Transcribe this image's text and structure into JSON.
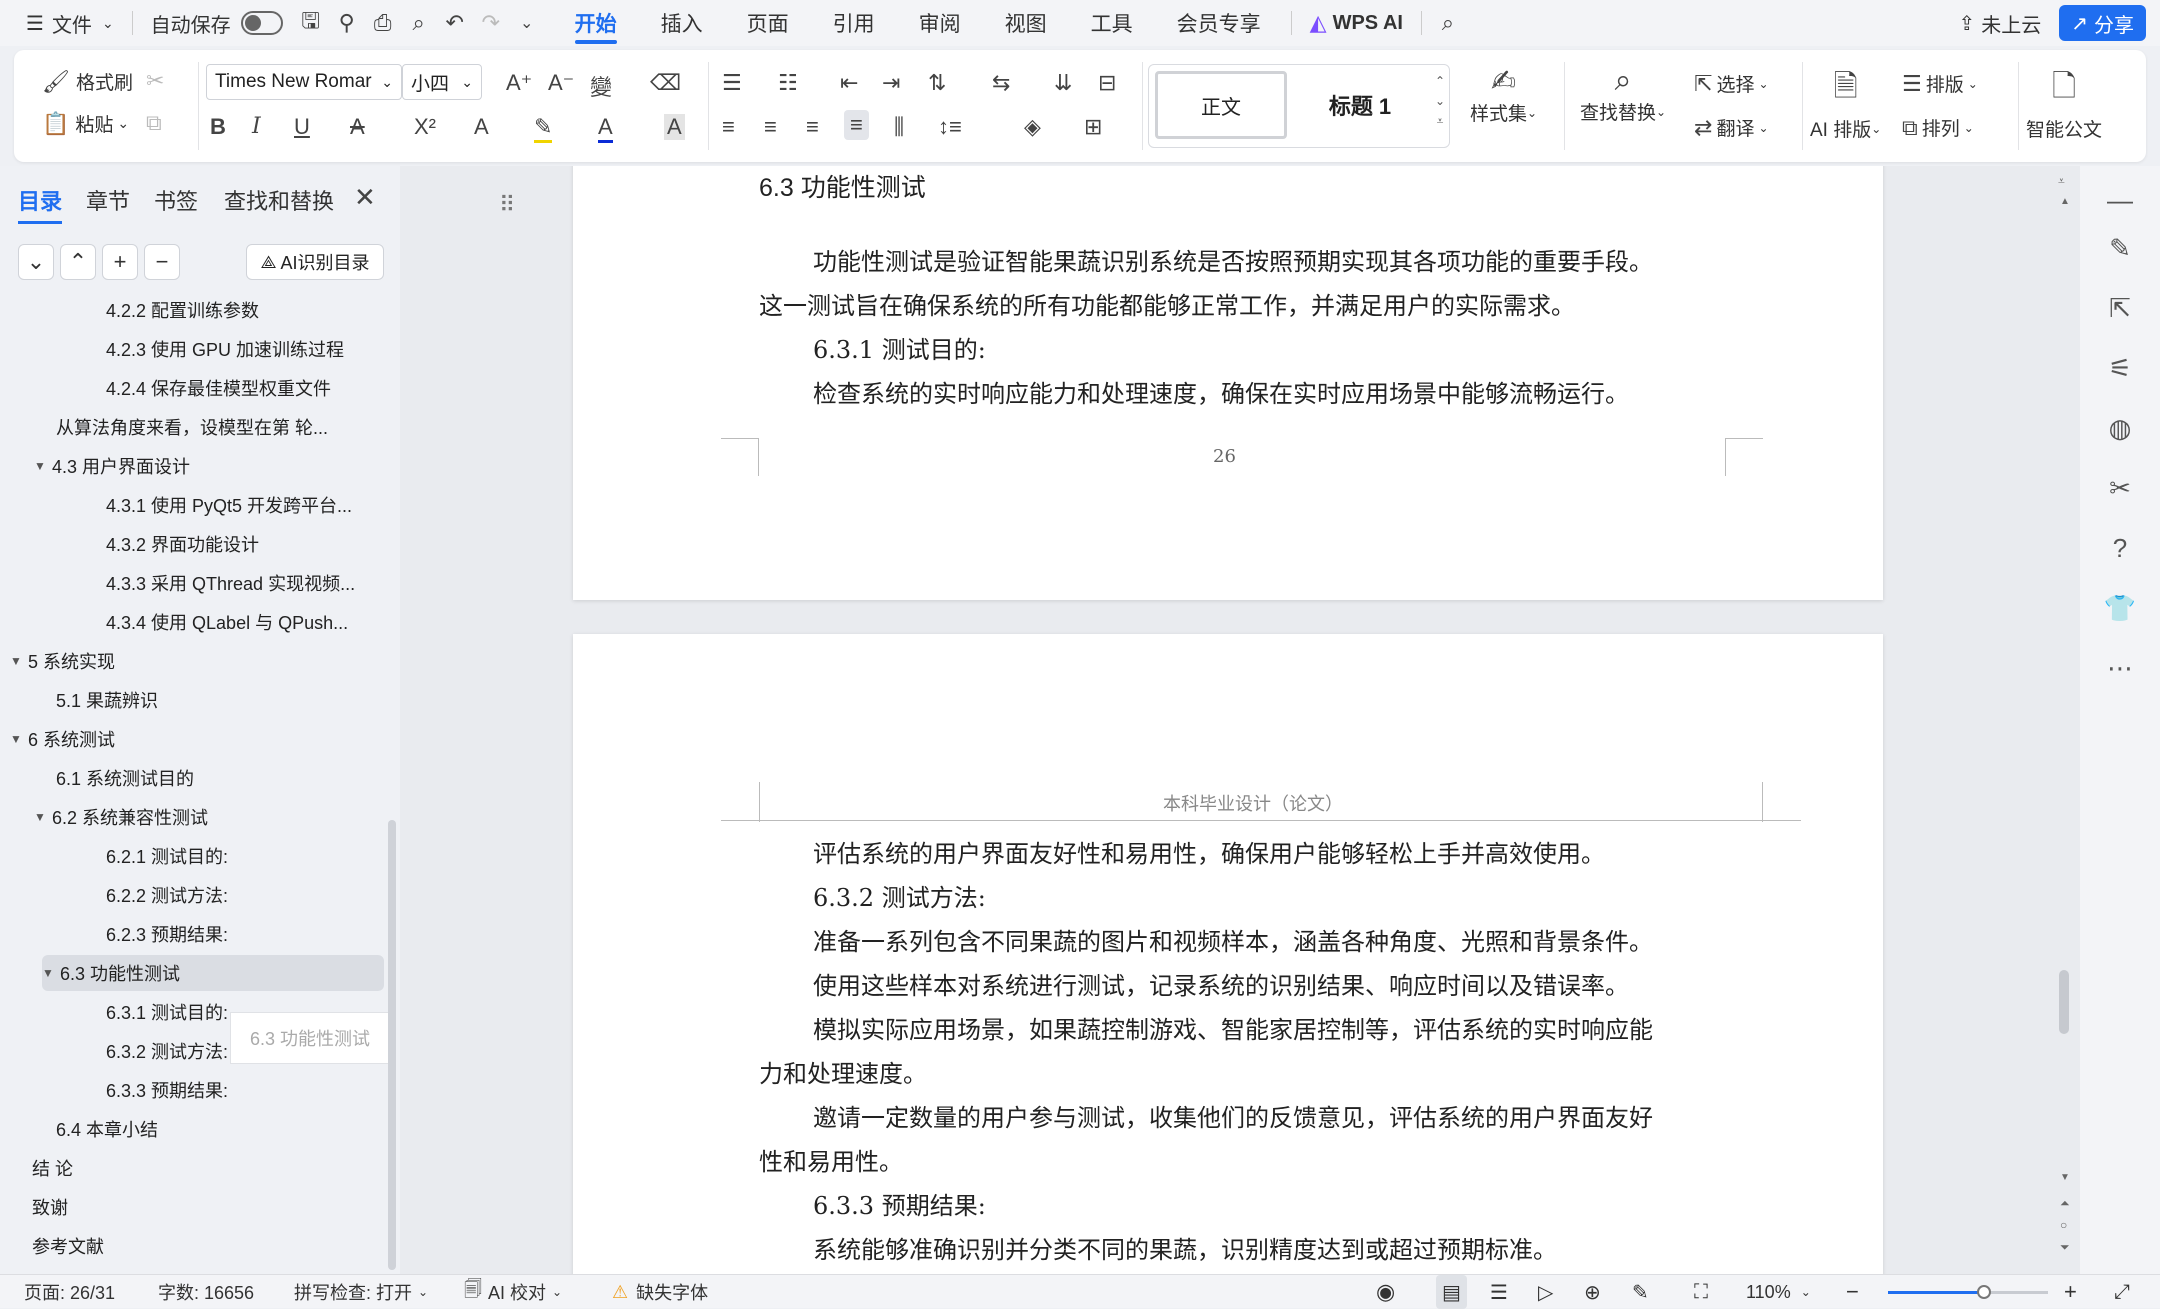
{
  "menubar": {
    "file_label": "文件",
    "autosave_label": "自动保存",
    "tabs": [
      "开始",
      "插入",
      "页面",
      "引用",
      "审阅",
      "视图",
      "工具",
      "会员专享"
    ],
    "wps_ai_label": "WPS AI",
    "cloud_label": "未上云",
    "share_label": "分享"
  },
  "ribbon": {
    "format_painter": "格式刷",
    "paste": "粘贴",
    "font_name": "Times New Romar",
    "font_size": "小四",
    "style_normal": "正文",
    "style_heading1": "标题 1",
    "style_set": "样式集",
    "find_replace": "查找替换",
    "select": "选择",
    "translate": "翻译",
    "ai_layout": "AI 排版",
    "typeset": "排版",
    "arrange": "排列",
    "smart_doc": "智能公文"
  },
  "sidebar": {
    "tabs": [
      "目录",
      "章节",
      "书签",
      "查找和替换"
    ],
    "ai_toc_label": "AI识别目录",
    "toc": [
      {
        "text": "4.2.2  配置训练参数",
        "level": 3,
        "arrow": ""
      },
      {
        "text": "4.2.3  使用  GPU  加速训练过程",
        "level": 3,
        "arrow": ""
      },
      {
        "text": "4.2.4  保存最佳模型权重文件",
        "level": 3,
        "arrow": ""
      },
      {
        "text": "从算法角度来看，设模型在第  轮...",
        "level": 2,
        "arrow": ""
      },
      {
        "text": "4.3 用户界面设计",
        "level": 2,
        "arrow": "▼"
      },
      {
        "text": "4.3.1  使用  PyQt5  开发跨平台...",
        "level": 3,
        "arrow": ""
      },
      {
        "text": "4.3.2  界面功能设计",
        "level": 3,
        "arrow": ""
      },
      {
        "text": "4.3.3  采用  QThread  实现视频...",
        "level": 3,
        "arrow": ""
      },
      {
        "text": "4.3.4  使用  QLabel  与  QPush...",
        "level": 3,
        "arrow": ""
      },
      {
        "text": "5 系统实现",
        "level": 1,
        "arrow": "▼"
      },
      {
        "text": "5.1  果蔬辨识",
        "level": 2,
        "arrow": ""
      },
      {
        "text": "6  系统测试",
        "level": 1,
        "arrow": "▼"
      },
      {
        "text": "6.1  系统测试目的",
        "level": 2,
        "arrow": ""
      },
      {
        "text": "6.2  系统兼容性测试",
        "level": 2,
        "arrow": "▼"
      },
      {
        "text": "6.2.1 测试目的:",
        "level": 3,
        "arrow": ""
      },
      {
        "text": "6.2.2 测试方法:",
        "level": 3,
        "arrow": ""
      },
      {
        "text": "6.2.3 预期结果:",
        "level": 3,
        "arrow": ""
      },
      {
        "text": "6.3  功能性测试",
        "level": 2,
        "arrow": "▼",
        "selected": true
      },
      {
        "text": "6.3.1 测试目的:",
        "level": 3,
        "arrow": ""
      },
      {
        "text": "6.3.2 测试方法:",
        "level": 3,
        "arrow": ""
      },
      {
        "text": "6.3.3 预期结果:",
        "level": 3,
        "arrow": ""
      },
      {
        "text": "6.4  本章小结",
        "level": 2,
        "arrow": ""
      },
      {
        "text": "结    论",
        "level": 1,
        "arrow": ""
      },
      {
        "text": "致谢",
        "level": 1,
        "arrow": ""
      },
      {
        "text": "参考文献",
        "level": 1,
        "arrow": ""
      }
    ],
    "drag_ghost": "6.3 功能性测试"
  },
  "document": {
    "page1": {
      "heading": "6.3  功能性测试",
      "lines": [
        "功能性测试是验证智能果蔬识别系统是否按照预期实现其各项功能的重要手段。",
        "这一测试旨在确保系统的所有功能都能够正常工作，并满足用户的实际需求。",
        "6.3.1 测试目的:",
        "检查系统的实时响应能力和处理速度，确保在实时应用场景中能够流畅运行。"
      ],
      "page_number": "26"
    },
    "page2": {
      "header": "本科毕业设计（论文）",
      "lines": [
        "评估系统的用户界面友好性和易用性，确保用户能够轻松上手并高效使用。",
        "6.3.2 测试方法:",
        "准备一系列包含不同果蔬的图片和视频样本，涵盖各种角度、光照和背景条件。",
        "使用这些样本对系统进行测试，记录系统的识别结果、响应时间以及错误率。",
        "模拟实际应用场景，如果蔬控制游戏、智能家居控制等，评估系统的实时响应能",
        "力和处理速度。",
        "邀请一定数量的用户参与测试，收集他们的反馈意见，评估系统的用户界面友好",
        "性和易用性。",
        "6.3.3 预期结果:",
        "系统能够准确识别并分类不同的果蔬，识别精度达到或超过预期标准。"
      ]
    }
  },
  "statusbar": {
    "page": "页面: 26/31",
    "words": "字数: 16656",
    "spellcheck": "拼写检查: 打开",
    "ai_proof": "AI 校对",
    "missing_font": "缺失字体",
    "zoom": "110%",
    "zoom_level": 0.6
  }
}
